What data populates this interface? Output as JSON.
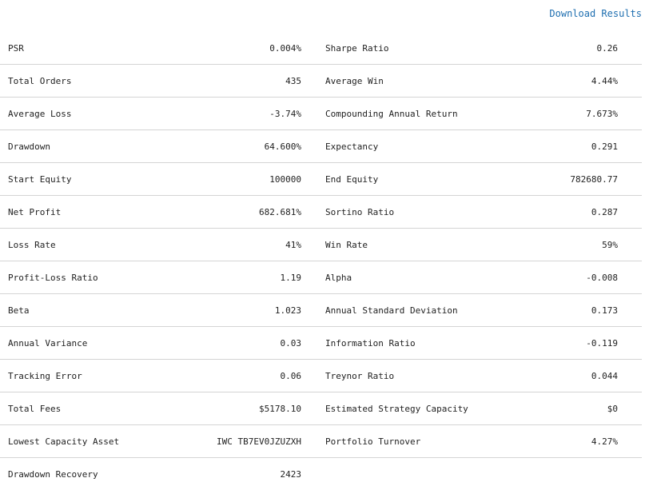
{
  "header": {
    "download_label": "Download Results"
  },
  "colors": {
    "link": "#1f6fb0",
    "divider": "#d4d4d4",
    "text": "#222222"
  },
  "rows": [
    {
      "left_label": "PSR",
      "left_value": "0.004%",
      "right_label": "Sharpe Ratio",
      "right_value": "0.26"
    },
    {
      "left_label": "Total Orders",
      "left_value": "435",
      "right_label": "Average Win",
      "right_value": "4.44%"
    },
    {
      "left_label": "Average Loss",
      "left_value": "-3.74%",
      "right_label": "Compounding Annual Return",
      "right_value": "7.673%"
    },
    {
      "left_label": "Drawdown",
      "left_value": "64.600%",
      "right_label": "Expectancy",
      "right_value": "0.291"
    },
    {
      "left_label": "Start Equity",
      "left_value": "100000",
      "right_label": "End Equity",
      "right_value": "782680.77"
    },
    {
      "left_label": "Net Profit",
      "left_value": "682.681%",
      "right_label": "Sortino Ratio",
      "right_value": "0.287"
    },
    {
      "left_label": "Loss Rate",
      "left_value": "41%",
      "right_label": "Win Rate",
      "right_value": "59%"
    },
    {
      "left_label": "Profit-Loss Ratio",
      "left_value": "1.19",
      "right_label": "Alpha",
      "right_value": "-0.008"
    },
    {
      "left_label": "Beta",
      "left_value": "1.023",
      "right_label": "Annual Standard Deviation",
      "right_value": "0.173"
    },
    {
      "left_label": "Annual Variance",
      "left_value": "0.03",
      "right_label": "Information Ratio",
      "right_value": "-0.119"
    },
    {
      "left_label": "Tracking Error",
      "left_value": "0.06",
      "right_label": "Treynor Ratio",
      "right_value": "0.044"
    },
    {
      "left_label": "Total Fees",
      "left_value": "$5178.10",
      "right_label": "Estimated Strategy Capacity",
      "right_value": "$0"
    },
    {
      "left_label": "Lowest Capacity Asset",
      "left_value": "IWC TB7EV0JZUZXH",
      "right_label": "Portfolio Turnover",
      "right_value": "4.27%"
    },
    {
      "left_label": "Drawdown Recovery",
      "left_value": "2423",
      "right_label": "",
      "right_value": ""
    }
  ]
}
